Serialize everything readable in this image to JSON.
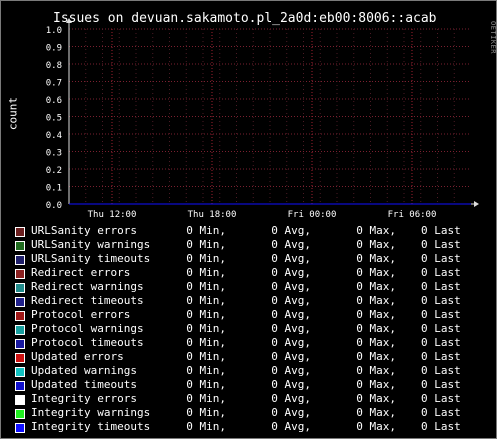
{
  "chart_data": {
    "type": "line",
    "title": "Issues on devuan.sakamoto.pl_2a0d:eb00:8006::acab",
    "ylabel": "count",
    "xlabel": "",
    "ylim": [
      0,
      1
    ],
    "y_ticks": [
      "0.0",
      "0.1",
      "0.2",
      "0.3",
      "0.4",
      "0.5",
      "0.6",
      "0.7",
      "0.8",
      "0.9",
      "1.0"
    ],
    "x_ticks": [
      "Thu 12:00",
      "Thu 18:00",
      "Fri 00:00",
      "Fri 06:00"
    ],
    "grid": true,
    "watermark": "RRDTOOL / TOBI OETIKER",
    "legend_placement": "bottom",
    "stat_labels": {
      "min": "Min,",
      "avg": "Avg,",
      "max": "Max,",
      "last": "Last"
    },
    "series": [
      {
        "name": "URLSanity errors",
        "color": "#6b1f1f",
        "min": "0",
        "avg": "0",
        "max": "0",
        "last": "0"
      },
      {
        "name": "URLSanity warnings",
        "color": "#1f6b1f",
        "min": "0",
        "avg": "0",
        "max": "0",
        "last": "0"
      },
      {
        "name": "URLSanity timeouts",
        "color": "#1f1f6b",
        "min": "0",
        "avg": "0",
        "max": "0",
        "last": "0"
      },
      {
        "name": "Redirect errors",
        "color": "#8a2020",
        "min": "0",
        "avg": "0",
        "max": "0",
        "last": "0"
      },
      {
        "name": "Redirect warnings",
        "color": "#208a8a",
        "min": "0",
        "avg": "0",
        "max": "0",
        "last": "0"
      },
      {
        "name": "Redirect timeouts",
        "color": "#20208a",
        "min": "0",
        "avg": "0",
        "max": "0",
        "last": "0"
      },
      {
        "name": "Protocol errors",
        "color": "#a01818",
        "min": "0",
        "avg": "0",
        "max": "0",
        "last": "0"
      },
      {
        "name": "Protocol warnings",
        "color": "#18a0a0",
        "min": "0",
        "avg": "0",
        "max": "0",
        "last": "0"
      },
      {
        "name": "Protocol timeouts",
        "color": "#1818a0",
        "min": "0",
        "avg": "0",
        "max": "0",
        "last": "0"
      },
      {
        "name": "Updated errors",
        "color": "#cc1010",
        "min": "0",
        "avg": "0",
        "max": "0",
        "last": "0"
      },
      {
        "name": "Updated warnings",
        "color": "#10c0c0",
        "min": "0",
        "avg": "0",
        "max": "0",
        "last": "0"
      },
      {
        "name": "Updated timeouts",
        "color": "#1010cc",
        "min": "0",
        "avg": "0",
        "max": "0",
        "last": "0"
      },
      {
        "name": "Integrity errors",
        "color": "#ffffff",
        "min": "0",
        "avg": "0",
        "max": "0",
        "last": "0"
      },
      {
        "name": "Integrity warnings",
        "color": "#20ee20",
        "min": "0",
        "avg": "0",
        "max": "0",
        "last": "0"
      },
      {
        "name": "Integrity timeouts",
        "color": "#1010ff",
        "min": "0",
        "avg": "0",
        "max": "0",
        "last": "0"
      }
    ]
  }
}
